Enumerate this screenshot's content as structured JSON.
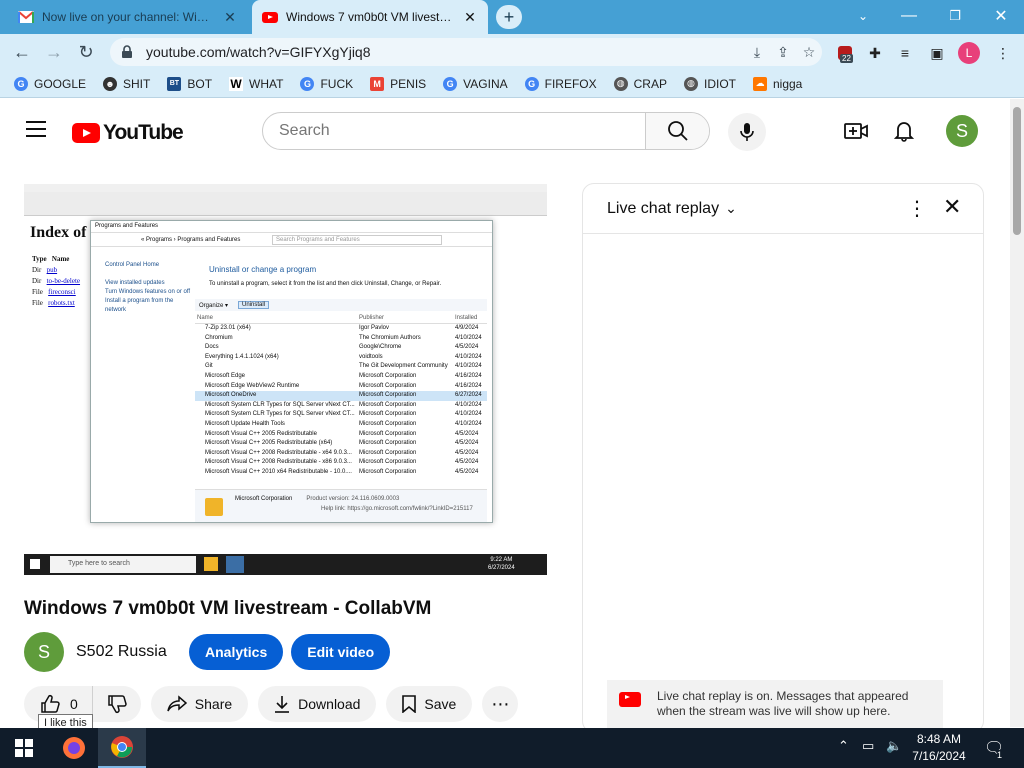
{
  "browser": {
    "tabs": [
      {
        "title": "Now live on your channel: Windo",
        "active": false
      },
      {
        "title": "Windows 7 vm0b0t VM livestream",
        "active": true
      }
    ],
    "new_tab_label": "+",
    "url": "youtube.com/watch?v=GIFYXgYjiq8",
    "extension_badge": "22",
    "profile_initial": "L",
    "bookmarks": [
      "GOOGLE",
      "SHIT",
      "BOT",
      "WHAT",
      "FUCK",
      "PENIS",
      "VAGINA",
      "FIREFOX",
      "CRAP",
      "IDIOT",
      "nigga"
    ]
  },
  "youtube": {
    "logo_text": "YouTube",
    "search_placeholder": "Search",
    "avatar_initial": "S",
    "video": {
      "title": "Windows 7 vm0b0t VM livestream - CollabVM",
      "channel_initial": "S",
      "channel_name": "S502 Russia",
      "analytics_label": "Analytics",
      "edit_label": "Edit video",
      "like_count": "0",
      "like_tooltip": "I like this",
      "share_label": "Share",
      "download_label": "Download",
      "save_label": "Save"
    },
    "chat": {
      "header": "Live chat replay",
      "notice": "Live chat replay is on. Messages that appeared when the stream was live will show up here."
    },
    "player_frame": {
      "index_title": "Index of",
      "index_cols": [
        "Type",
        "Name"
      ],
      "index_rows": [
        [
          "Dir",
          "pub"
        ],
        [
          "Dir",
          "to-be-delete"
        ],
        [
          "File",
          "fireconsci"
        ],
        [
          "File",
          "robots.txt"
        ]
      ],
      "window_title": "Programs and Features",
      "breadcrumb": "« Programs › Programs and Features",
      "search_hint": "Search Programs and Features",
      "side_links": [
        "Control Panel Home",
        "View installed updates",
        "Turn Windows features on or off",
        "Install a program from the network"
      ],
      "heading": "Uninstall or change a program",
      "subheading": "To uninstall a program, select it from the list and then click Uninstall, Change, or Repair.",
      "organize": "Organize ▾",
      "uninstall": "Uninstall",
      "columns": [
        "Name",
        "Publisher",
        "Installed"
      ],
      "programs": [
        [
          "7-Zip 23.01 (x64)",
          "Igor Pavlov",
          "4/9/2024"
        ],
        [
          "Chromium",
          "The Chromium Authors",
          "4/10/2024"
        ],
        [
          "Docs",
          "Google\\Chrome",
          "4/5/2024"
        ],
        [
          "Everything 1.4.1.1024 (x64)",
          "voidtools",
          "4/10/2024"
        ],
        [
          "Git",
          "The Git Development Community",
          "4/10/2024"
        ],
        [
          "Microsoft Edge",
          "Microsoft Corporation",
          "4/16/2024"
        ],
        [
          "Microsoft Edge WebView2 Runtime",
          "Microsoft Corporation",
          "4/16/2024"
        ],
        [
          "Microsoft OneDrive",
          "Microsoft Corporation",
          "6/27/2024"
        ],
        [
          "Microsoft System CLR Types for SQL Server vNext CT...",
          "Microsoft Corporation",
          "4/10/2024"
        ],
        [
          "Microsoft System CLR Types for SQL Server vNext CT...",
          "Microsoft Corporation",
          "4/10/2024"
        ],
        [
          "Microsoft Update Health Tools",
          "Microsoft Corporation",
          "4/10/2024"
        ],
        [
          "Microsoft Visual C++ 2005 Redistributable",
          "Microsoft Corporation",
          "4/5/2024"
        ],
        [
          "Microsoft Visual C++ 2005 Redistributable (x64)",
          "Microsoft Corporation",
          "4/5/2024"
        ],
        [
          "Microsoft Visual C++ 2008 Redistributable - x64 9.0.3...",
          "Microsoft Corporation",
          "4/5/2024"
        ],
        [
          "Microsoft Visual C++ 2008 Redistributable - x86 9.0.3...",
          "Microsoft Corporation",
          "4/5/2024"
        ],
        [
          "Microsoft Visual C++ 2010 x64 Redistributable - 10.0....",
          "Microsoft Corporation",
          "4/5/2024"
        ]
      ],
      "details_publisher": "Microsoft Corporation",
      "details_version": "Product version: 24.116.0609.0003",
      "details_help": "Help link: https://go.microsoft.com/fwlink/?LinkID=215117",
      "vm_search": "Type here to search",
      "vm_time": "9:22 AM",
      "vm_date": "6/27/2024"
    }
  },
  "taskbar": {
    "time": "8:48 AM",
    "date": "7/16/2024",
    "notification_count": "1"
  }
}
